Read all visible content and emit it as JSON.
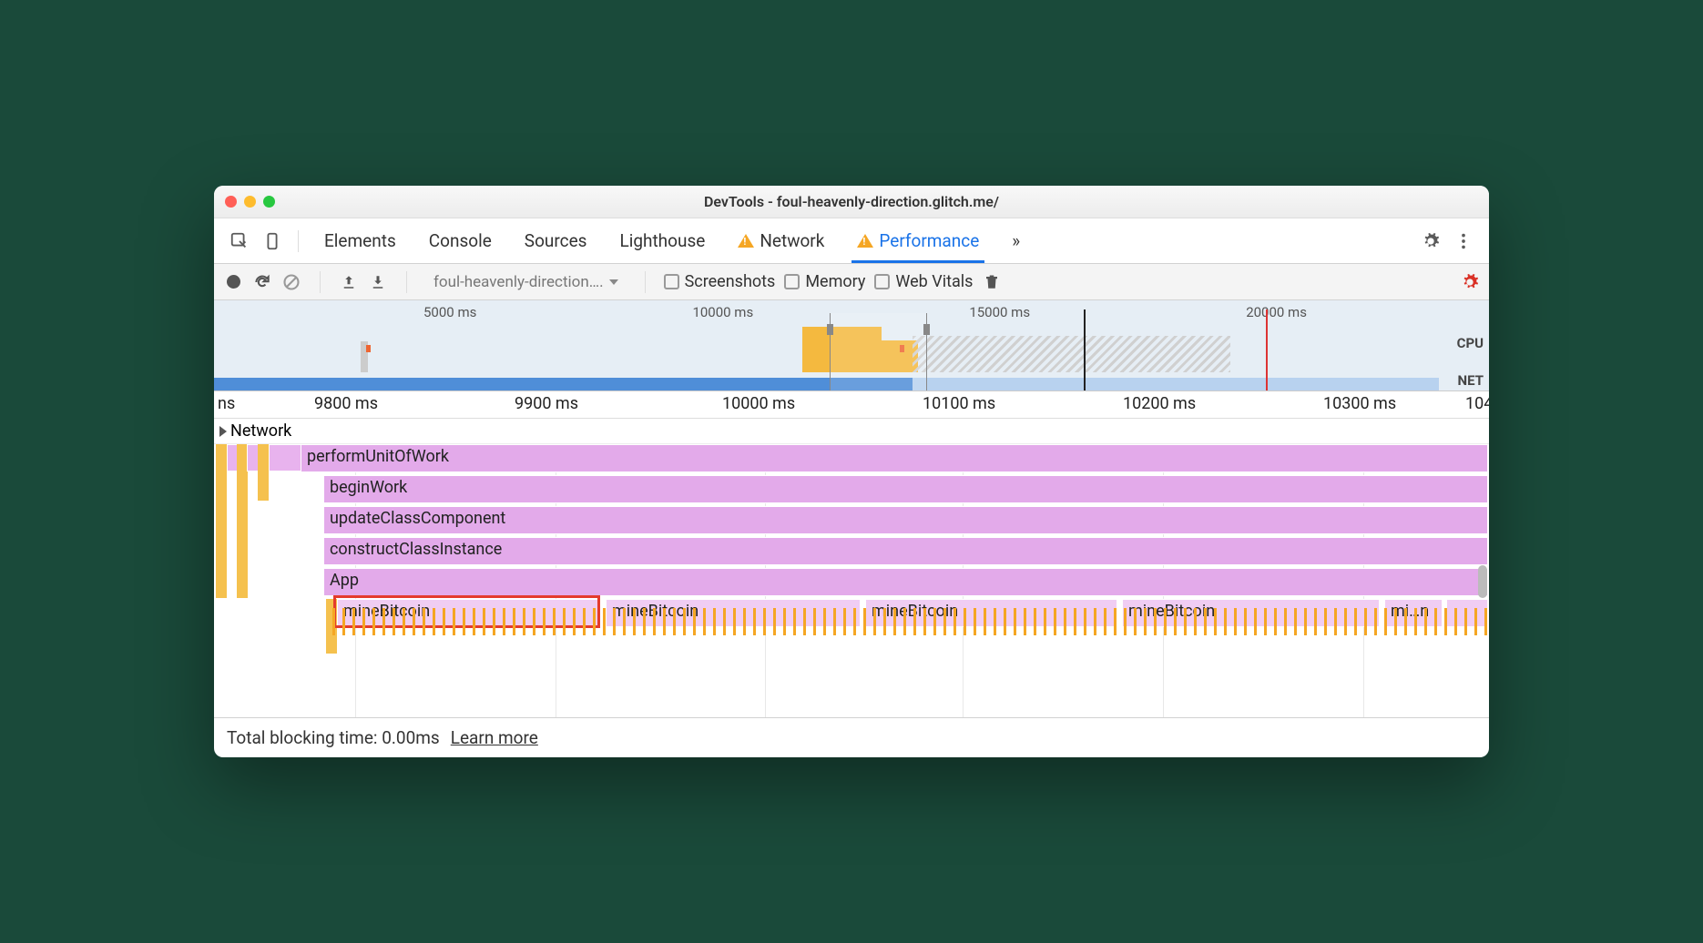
{
  "window": {
    "title": "DevTools - foul-heavenly-direction.glitch.me/"
  },
  "tabs": {
    "elements": "Elements",
    "console": "Console",
    "sources": "Sources",
    "lighthouse": "Lighthouse",
    "network": "Network",
    "performance": "Performance",
    "more": "»"
  },
  "toolbar": {
    "selector": "foul-heavenly-direction….",
    "screenshots": "Screenshots",
    "memory": "Memory",
    "webvitals": "Web Vitals"
  },
  "overview": {
    "ticks": [
      "5000 ms",
      "10000 ms",
      "15000 ms",
      "20000 ms"
    ],
    "cpu_label": "CPU",
    "net_label": "NET"
  },
  "ruler": {
    "labels": [
      "ns",
      "9800 ms",
      "9900 ms",
      "10000 ms",
      "10100 ms",
      "10200 ms",
      "10300 ms",
      "104"
    ]
  },
  "section": {
    "network": "Network"
  },
  "flame": {
    "rows": [
      "performUnitOfWork",
      "beginWork",
      "updateClassComponent",
      "constructClassInstance",
      "App"
    ],
    "mine": [
      "mineBitcoin",
      "mineBitcoin",
      "mineBitcoin",
      "mineBitcoin",
      "mi…n"
    ]
  },
  "footer": {
    "tbt": "Total blocking time: 0.00ms",
    "learn": "Learn more"
  }
}
